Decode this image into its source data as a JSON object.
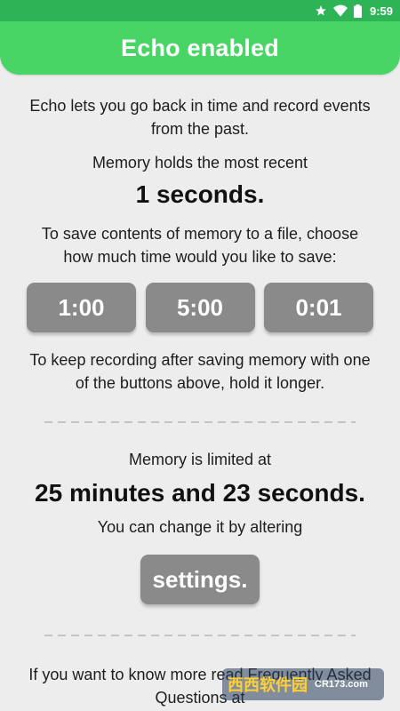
{
  "status_bar": {
    "time": "9:59",
    "icons": [
      "star-icon",
      "wifi-icon",
      "battery-icon"
    ]
  },
  "header": {
    "title": "Echo enabled",
    "color": "#49d466"
  },
  "intro": {
    "line1": "Echo lets you go back in time and record events",
    "line2": "from the past."
  },
  "memory": {
    "label": "Memory holds the most recent",
    "value": "1 seconds."
  },
  "save": {
    "line1": "To save contents of memory to a file, choose",
    "line2": "how much time would you like to save:",
    "buttons": [
      "1:00",
      "5:00",
      "0:01"
    ]
  },
  "keep": {
    "line1": "To keep recording after saving memory with one",
    "line2": "of the buttons above, hold it longer."
  },
  "limit": {
    "label": "Memory is limited at",
    "value": "25 minutes and 23 seconds.",
    "change_text": "You can change it by altering",
    "settings_button": "settings."
  },
  "faq": {
    "line1": "If you want to know more read Frequently Asked",
    "line2": "Questions at"
  },
  "watermark": {
    "text": "西西软件园",
    "sub": "CR173.com"
  }
}
